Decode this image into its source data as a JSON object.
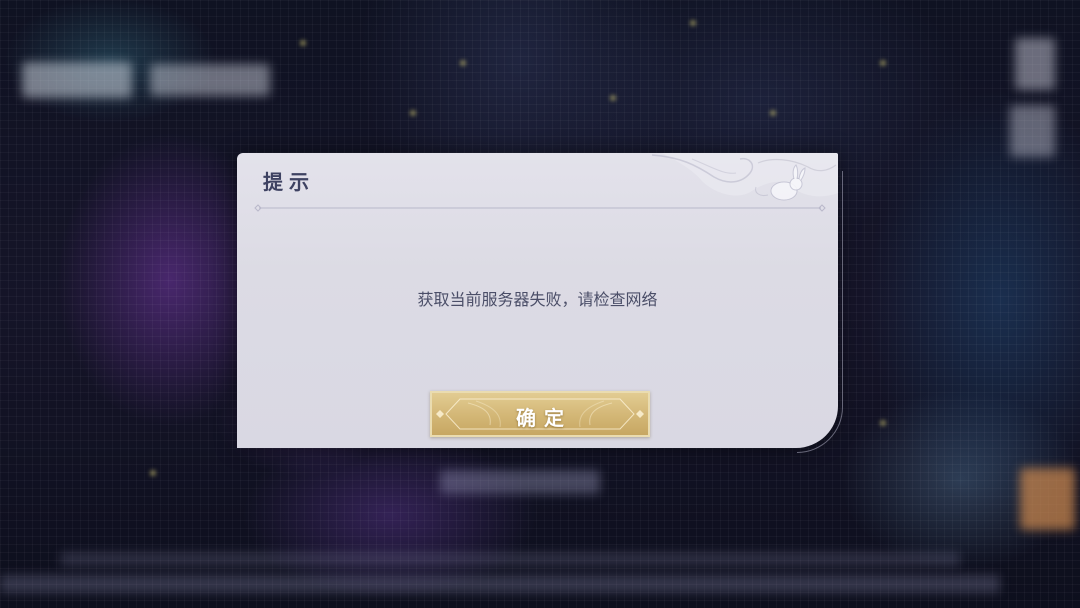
{
  "dialog": {
    "title": "提示",
    "message": "获取当前服务器失败，请检查网络",
    "confirm_label": "确定"
  },
  "icons": {
    "ornament": "rabbit-cloud-ornament-icon",
    "divider": "diamond-divider-icon",
    "button_frame": "button-frame-icon"
  },
  "colors": {
    "dialog_bg": "#dcdbe4",
    "title": "#3e4262",
    "text": "#4b4e68",
    "gold": "#d4b878"
  }
}
